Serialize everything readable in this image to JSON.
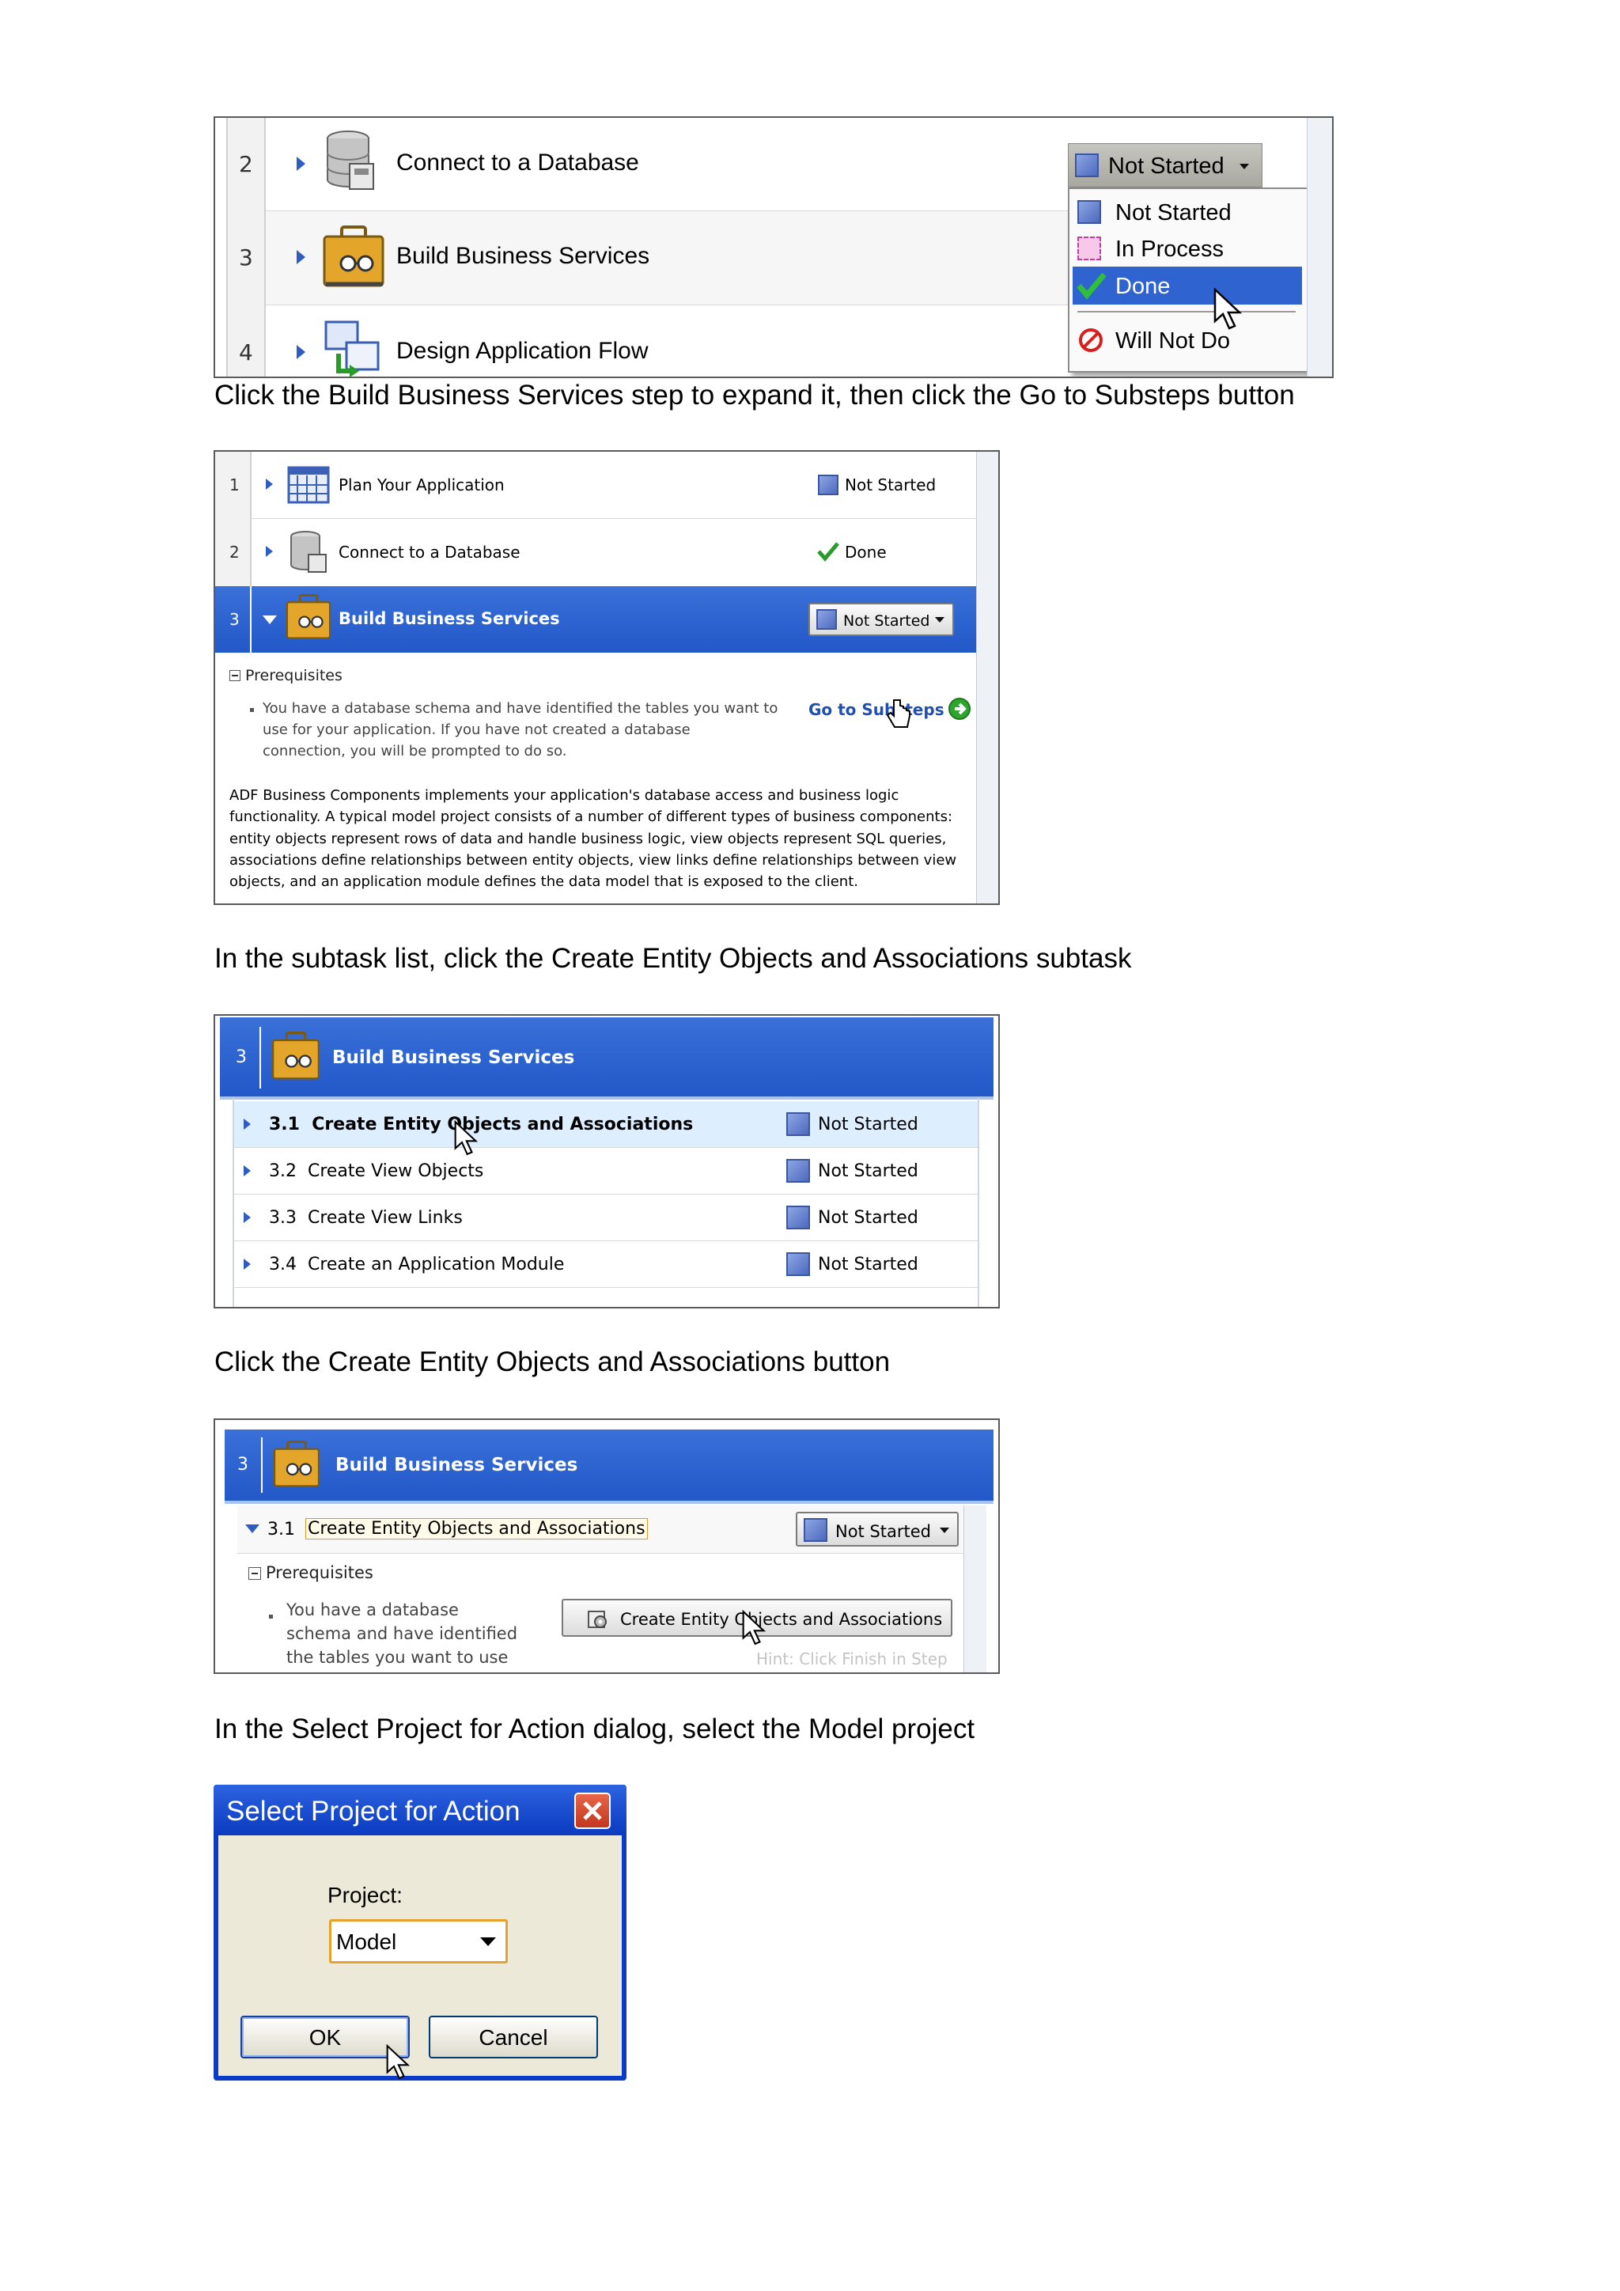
{
  "captions": [
    "Click the Build Business Services step to expand it, then click the Go to Substeps button",
    "In the subtask list, click the Create Entity Objects and Associations subtask",
    "Click the Create Entity Objects and Associations button",
    "In the Select Project for Action dialog, select the Model project"
  ],
  "shot1": {
    "steps": [
      {
        "num": "2",
        "label": "Connect to a Database"
      },
      {
        "num": "3",
        "label": "Build Business Services"
      },
      {
        "num": "4",
        "label": "Design Application Flow"
      }
    ],
    "status_button": "Not Started",
    "menu": [
      "Not Started",
      "In Process",
      "Done",
      "Will Not Do"
    ]
  },
  "shot2": {
    "steps": [
      {
        "num": "1",
        "label": "Plan Your Application",
        "status": "Not Started"
      },
      {
        "num": "2",
        "label": "Connect to a Database",
        "status": "Done"
      },
      {
        "num": "3",
        "label": "Build Business Services",
        "status": "Not Started"
      }
    ],
    "prereq_title": "Prerequisites",
    "prereq_lines": [
      "You have a database schema and have identified the tables you want to",
      "use for your application. If you have not created a database",
      "connection, you will be prompted to do so."
    ],
    "go_substeps": "Go to Substeps",
    "desc_lines": [
      "ADF Business Components implements your application's database access and business logic",
      "functionality. A typical model project consists of a number of different types of business components:",
      "entity objects represent rows of data and handle business logic, view objects represent SQL queries,",
      "associations define relationships between entity objects, view links define relationships between view",
      "objects, and an application module defines the data model that is exposed to the client."
    ]
  },
  "shot3": {
    "header_num": "3",
    "header_label": "Build Business Services",
    "subtasks": [
      {
        "label": "3.1  Create Entity Objects and Associations",
        "status": "Not Started"
      },
      {
        "label": "3.2  Create View Objects",
        "status": "Not Started"
      },
      {
        "label": "3.3  Create View Links",
        "status": "Not Started"
      },
      {
        "label": "3.4  Create an Application Module",
        "status": "Not Started"
      }
    ]
  },
  "shot4": {
    "header_num": "3",
    "header_label": "Build Business Services",
    "sub_num": "3.1",
    "sub_label": "Create Entity Objects and Associations",
    "status": "Not Started",
    "prereq_title": "Prerequisites",
    "prereq_lines": [
      "You have a database",
      "schema and have identified",
      "the tables you want to use"
    ],
    "button": "Create Entity Objects and Associations",
    "hint": "Hint: Click Finish in Step"
  },
  "dialog": {
    "title": "Select Project for Action",
    "project_label": "Project:",
    "project_value": "Model",
    "ok": "OK",
    "cancel": "Cancel"
  }
}
